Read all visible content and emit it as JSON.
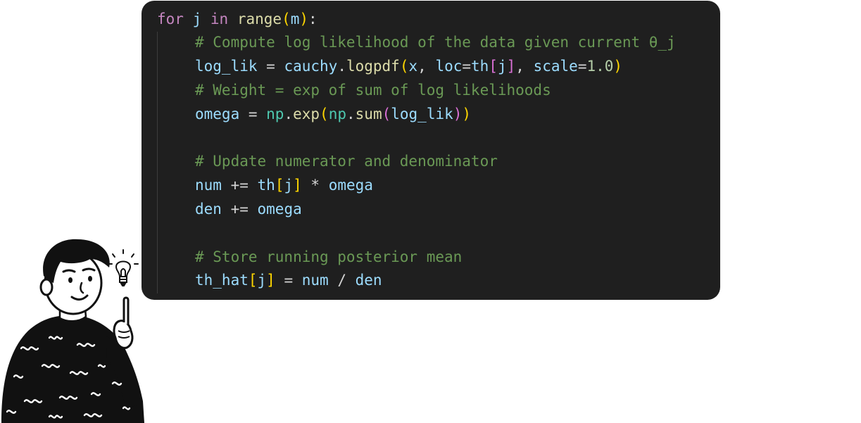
{
  "code": {
    "line1": {
      "kw_for": "for",
      "var_j": "j",
      "kw_in": "in",
      "fn_range": "range",
      "p_open": "(",
      "var_m": "m",
      "p_close": ")",
      "colon": ":"
    },
    "line2": {
      "comment": "# Compute log likelihood of the data given current θ_j"
    },
    "line3": {
      "var_loglik": "log_lik",
      "eq": " = ",
      "mod_cauchy": "cauchy",
      "dot": ".",
      "fn_logpdf": "logpdf",
      "p_open": "(",
      "var_x": "x",
      "comma1": ", ",
      "var_loc": "loc",
      "eq2": "=",
      "var_th": "th",
      "b_open": "[",
      "var_j": "j",
      "b_close": "]",
      "comma2": ", ",
      "var_scale": "scale",
      "eq3": "=",
      "num_val": "1.0",
      "p_close": ")"
    },
    "line4": {
      "comment": "# Weight = exp of sum of log likelihoods"
    },
    "line5": {
      "var_omega": "omega",
      "eq": " = ",
      "mod_np1": "np",
      "dot1": ".",
      "fn_exp": "exp",
      "p1_open": "(",
      "mod_np2": "np",
      "dot2": ".",
      "fn_sum": "sum",
      "p2_open": "(",
      "var_loglik": "log_lik",
      "p2_close": ")",
      "p1_close": ")"
    },
    "line6": {
      "comment": "# Update numerator and denominator"
    },
    "line7": {
      "var_num": "num",
      "op": " += ",
      "var_th": "th",
      "b_open": "[",
      "var_j": "j",
      "b_close": "]",
      "op2": " * ",
      "var_omega": "omega"
    },
    "line8": {
      "var_den": "den",
      "op": " += ",
      "var_omega": "omega"
    },
    "line9": {
      "comment": "# Store running posterior mean"
    },
    "line10": {
      "var_thhat": "th_hat",
      "b_open": "[",
      "var_j": "j",
      "b_close": "]",
      "eq": " = ",
      "var_num": "num",
      "op": " / ",
      "var_den": "den"
    }
  },
  "colors": {
    "editor_background": "#1f1f1f",
    "keyword": "#c586c0",
    "function": "#dcdcaa",
    "variable": "#9cdcfe",
    "module": "#4ec9b0",
    "number": "#b5cea8",
    "comment": "#6a9955"
  },
  "icons": {
    "illustration": "person-with-idea-icon",
    "lightbulb": "lightbulb-icon"
  }
}
